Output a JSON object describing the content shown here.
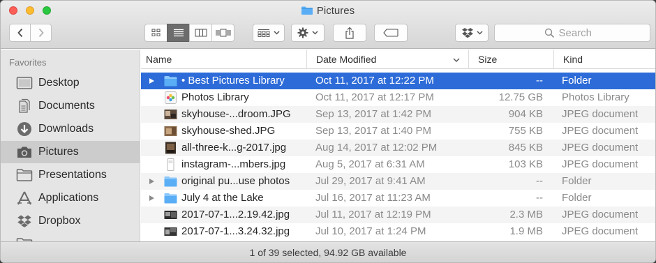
{
  "window": {
    "title": "Pictures",
    "title_icon": "folder-icon"
  },
  "toolbar": {
    "back_icon": "chevron-left-icon",
    "forward_icon": "chevron-right-icon",
    "view_modes": [
      "icon-view",
      "list-view",
      "column-view",
      "cover-flow-view"
    ],
    "active_view": "list-view",
    "arrange_icon": "arrange-grid-icon",
    "action_icon": "gear-icon",
    "share_icon": "share-icon",
    "tags_icon": "tag-icon",
    "dropbox_icon": "dropbox-icon",
    "search_placeholder": "Search"
  },
  "sidebar": {
    "heading": "Favorites",
    "items": [
      {
        "label": "Desktop",
        "icon": "desktop-icon"
      },
      {
        "label": "Documents",
        "icon": "documents-icon"
      },
      {
        "label": "Downloads",
        "icon": "downloads-icon"
      },
      {
        "label": "Pictures",
        "icon": "camera-icon",
        "selected": true
      },
      {
        "label": "Presentations",
        "icon": "folder-icon"
      },
      {
        "label": "Applications",
        "icon": "applications-icon"
      },
      {
        "label": "Dropbox",
        "icon": "dropbox-icon"
      }
    ]
  },
  "list": {
    "columns": {
      "name": "Name",
      "date": "Date Modified",
      "size": "Size",
      "kind": "Kind"
    },
    "rows": [
      {
        "name": "• Best Pictures Library",
        "date": "Oct 11, 2017 at 12:22 PM",
        "size": "--",
        "kind": "Folder",
        "icon": "folder-icon",
        "expandable": true,
        "selected": true
      },
      {
        "name": "Photos Library",
        "date": "Oct 11, 2017 at 12:17 PM",
        "size": "12.75 GB",
        "kind": "Photos Library",
        "icon": "photos-library-icon"
      },
      {
        "name": "skyhouse-...droom.JPG",
        "date": "Sep 13, 2017 at 1:42 PM",
        "size": "904 KB",
        "kind": "JPEG document",
        "icon": "image-thumbnail-icon"
      },
      {
        "name": "skyhouse-shed.JPG",
        "date": "Sep 13, 2017 at 1:40 PM",
        "size": "755 KB",
        "kind": "JPEG document",
        "icon": "image-thumbnail-icon"
      },
      {
        "name": "all-three-k...g-2017.jpg",
        "date": "Aug 14, 2017 at 12:02 PM",
        "size": "845 KB",
        "kind": "JPEG document",
        "icon": "image-thumbnail-icon"
      },
      {
        "name": "instagram-...mbers.jpg",
        "date": "Aug 5, 2017 at 6:31 AM",
        "size": "103 KB",
        "kind": "JPEG document",
        "icon": "image-thumbnail-icon"
      },
      {
        "name": "original pu...use photos",
        "date": "Jul 29, 2017 at 9:41 AM",
        "size": "--",
        "kind": "Folder",
        "icon": "folder-icon",
        "expandable": true
      },
      {
        "name": "July 4 at the Lake",
        "date": "Jul 16, 2017 at 11:23 AM",
        "size": "--",
        "kind": "Folder",
        "icon": "folder-icon",
        "expandable": true
      },
      {
        "name": "2017-07-1...2.19.42.jpg",
        "date": "Jul 11, 2017 at 12:19 PM",
        "size": "2.3 MB",
        "kind": "JPEG document",
        "icon": "image-thumbnail-icon"
      },
      {
        "name": "2017-07-1...3.24.32.jpg",
        "date": "Jul 10, 2017 at 1:24 PM",
        "size": "1.9 MB",
        "kind": "JPEG document",
        "icon": "image-thumbnail-icon"
      }
    ]
  },
  "status": {
    "text": "1 of 39 selected, 94.92 GB available"
  },
  "colors": {
    "selection": "#2d6bd8",
    "folder": "#5aaef5",
    "sidebar_bg": "#e6e5e6"
  }
}
